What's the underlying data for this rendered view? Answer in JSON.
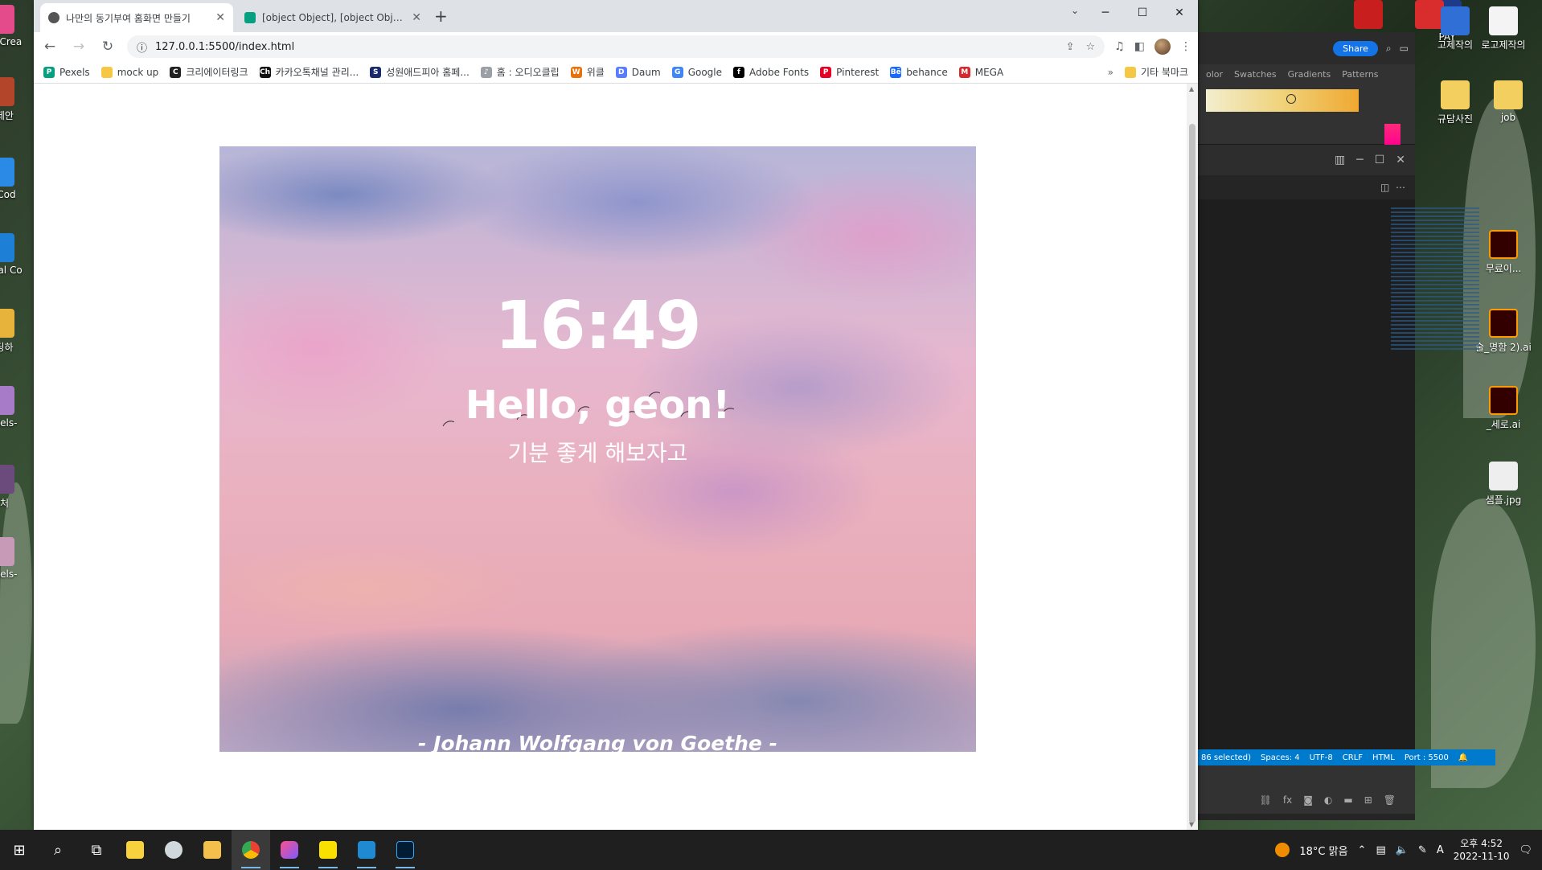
{
  "browser": {
    "tabs": [
      {
        "title": "나만의 동기부여 홈화면 만들기",
        "active": true,
        "close": "✕"
      },
      {
        "title": "[object Object], [object Object]",
        "active": false,
        "close": "✕"
      }
    ],
    "new_tab": "+",
    "window_controls": {
      "minimize": "─",
      "maximize": "☐",
      "close": "✕"
    },
    "tab_search": "⌄",
    "url": "127.0.0.1:5500/index.html",
    "bookmarks": [
      {
        "label": "Pexels",
        "color": "#05a081",
        "glyph": "P"
      },
      {
        "label": "mock up",
        "color": "#f6c744",
        "glyph": ""
      },
      {
        "label": "크리에이터링크",
        "color": "#222222",
        "glyph": "C"
      },
      {
        "label": "카카오톡채널 관리...",
        "color": "#111111",
        "glyph": "Ch"
      },
      {
        "label": "성원애드피아 홈페...",
        "color": "#1a2a6c",
        "glyph": "S"
      },
      {
        "label": "홈 : 오디오클립",
        "color": "#9aa0a6",
        "glyph": "♪"
      },
      {
        "label": "위클",
        "color": "#e8710a",
        "glyph": "W"
      },
      {
        "label": "Daum",
        "color": "#5a7cff",
        "glyph": "D"
      },
      {
        "label": "Google",
        "color": "#4285f4",
        "glyph": "G"
      },
      {
        "label": "Adobe Fonts",
        "color": "#000000",
        "glyph": "f"
      },
      {
        "label": "Pinterest",
        "color": "#e60023",
        "glyph": "P"
      },
      {
        "label": "behance",
        "color": "#1769ff",
        "glyph": "Bē"
      },
      {
        "label": "MEGA",
        "color": "#d9272e",
        "glyph": "M"
      }
    ],
    "bookmarks_more": "»",
    "other_bookmarks": "기타 북마크"
  },
  "page": {
    "clock": "16:49",
    "greeting": "Hello, geon!",
    "mood": "기분 좋게 해보자고",
    "quote_author": "- Johann Wolfgang von Goethe -"
  },
  "side_app": {
    "share": "Share",
    "panel_tabs": [
      "olor",
      "Swatches",
      "Gradients",
      "Patterns"
    ],
    "status_items": [
      "86 selected)",
      "Spaces: 4",
      "UTF-8",
      "CRLF",
      "HTML",
      "Port : 5500"
    ]
  },
  "desktop": {
    "left_icons": [
      "Ado Crea",
      "BI제안",
      "VSCod",
      "Visual Co",
      "코딩하",
      "pexels-",
      "캡처",
      "pexels-"
    ],
    "right_icons": [
      "PAY",
      "고제작의",
      "로고제작의",
      "규담사진",
      "job",
      "무료이...",
      "술_명함 2).ai",
      "_세로.ai",
      "샘플.jpg"
    ]
  },
  "taskbar": {
    "weather": "18°C 맑음",
    "time": "오후 4:52",
    "date": "2022-11-10",
    "ime": "A"
  }
}
